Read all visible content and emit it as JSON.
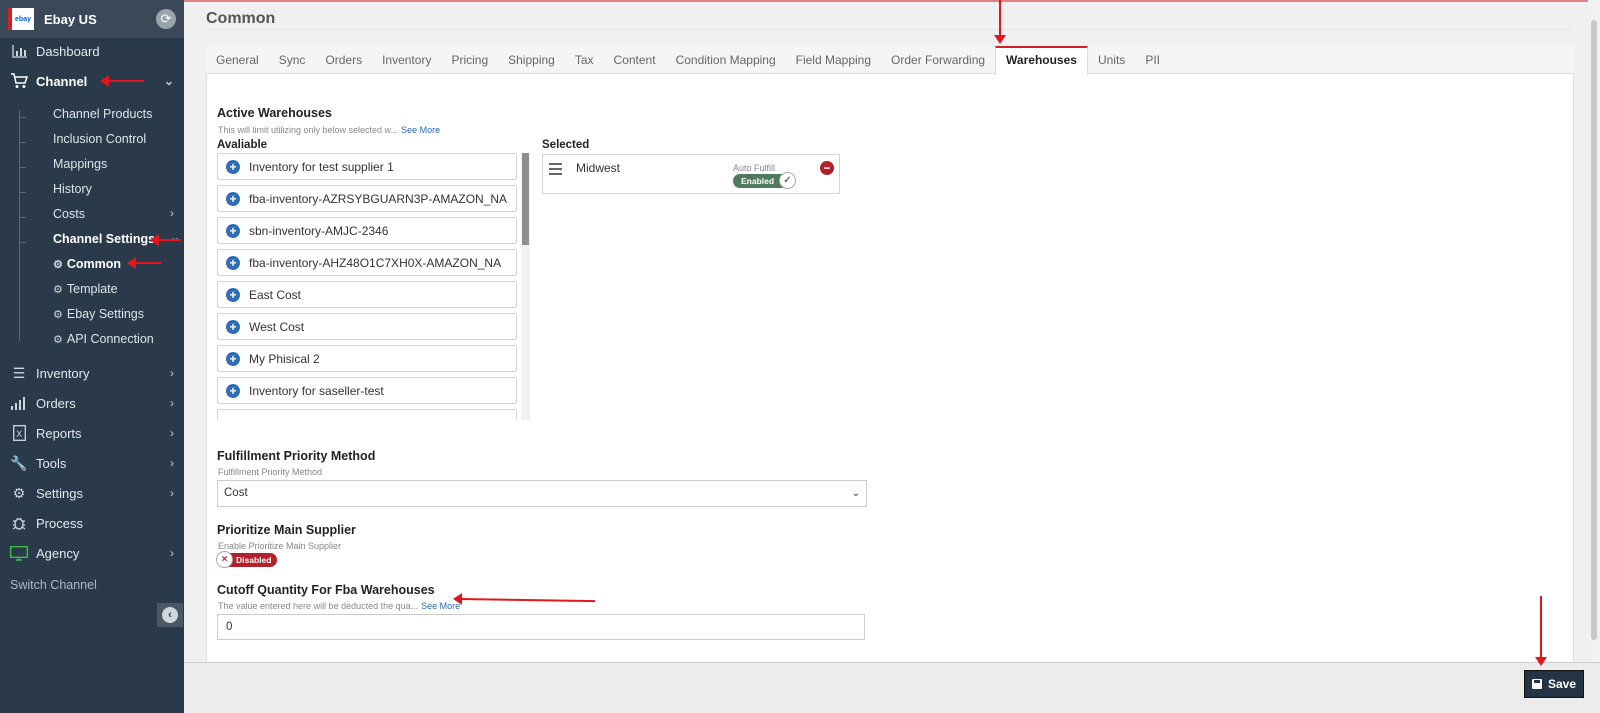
{
  "sidebar": {
    "channel_name": "Ebay US",
    "logo_text": "ebay",
    "items": [
      {
        "label": "Dashboard"
      },
      {
        "label": "Channel"
      },
      {
        "label": "Inventory"
      },
      {
        "label": "Orders"
      },
      {
        "label": "Reports"
      },
      {
        "label": "Tools"
      },
      {
        "label": "Settings"
      },
      {
        "label": "Process"
      },
      {
        "label": "Agency"
      }
    ],
    "channel_sub": [
      {
        "label": "Channel Products"
      },
      {
        "label": "Inclusion Control"
      },
      {
        "label": "Mappings"
      },
      {
        "label": "History"
      },
      {
        "label": "Costs"
      },
      {
        "label": "Channel Settings"
      }
    ],
    "settings_sub": [
      {
        "label": "Common"
      },
      {
        "label": "Template"
      },
      {
        "label": "Ebay Settings"
      },
      {
        "label": "API Connection"
      }
    ],
    "switch_channel": "Switch Channel"
  },
  "page": {
    "title": "Common",
    "tabs": [
      {
        "label": "General"
      },
      {
        "label": "Sync"
      },
      {
        "label": "Orders"
      },
      {
        "label": "Inventory"
      },
      {
        "label": "Pricing"
      },
      {
        "label": "Shipping"
      },
      {
        "label": "Tax"
      },
      {
        "label": "Content"
      },
      {
        "label": "Condition Mapping"
      },
      {
        "label": "Field Mapping"
      },
      {
        "label": "Order Forwarding"
      },
      {
        "label": "Warehouses"
      },
      {
        "label": "Units"
      },
      {
        "label": "PII"
      }
    ],
    "active_tab": "Warehouses"
  },
  "warehouses": {
    "title": "Active Warehouses",
    "hint": "This will limit utilizing only below selected w...",
    "see_more": "See More",
    "available_label": "Avaliable",
    "selected_label": "Selected",
    "available": [
      {
        "label": "Inventory for test supplier 1"
      },
      {
        "label": "fba-inventory-AZRSYBGUARN3P-AMAZON_NA"
      },
      {
        "label": "sbn-inventory-AMJC-2346"
      },
      {
        "label": "fba-inventory-AHZ48O1C7XH0X-AMAZON_NA"
      },
      {
        "label": "East Cost"
      },
      {
        "label": "West Cost"
      },
      {
        "label": "My Phisical 2"
      },
      {
        "label": "Inventory for saseller-test"
      }
    ],
    "selected": {
      "name": "Midwest",
      "auto_fulfill_label": "Auto Fulfill",
      "auto_fulfill_state": "Enabled"
    }
  },
  "fulfillment": {
    "title": "Fulfillment Priority Method",
    "hint": "Fulfillment Priority Method",
    "value": "Cost"
  },
  "main_supplier": {
    "title": "Prioritize Main Supplier",
    "hint": "Enable Prioritize Main Supplier",
    "state": "Disabled"
  },
  "cutoff": {
    "title": "Cutoff Quantity For Fba Warehouses",
    "hint": "The value entered here will be deducted the qua...",
    "see_more": "See More",
    "value": "0"
  },
  "footer": {
    "save_label": "Save"
  },
  "colors": {
    "sidebar_bg": "#2b3a4a",
    "accent_red": "#d32027",
    "enabled_green": "#4f7a5e",
    "disabled_red": "#b2202b",
    "plus_blue": "#2f6db5"
  }
}
